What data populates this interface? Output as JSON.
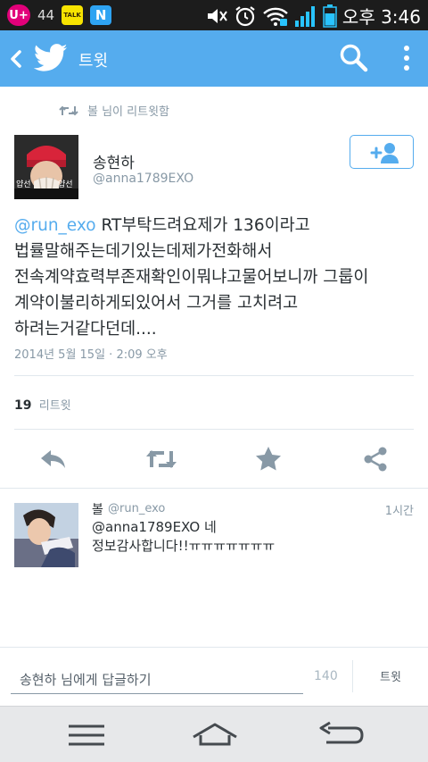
{
  "status_bar": {
    "carrier": "U+",
    "signal_number": "44",
    "talk_label": "TALK",
    "n_label": "N",
    "time": "오후 3:46",
    "icons": [
      "mute-icon",
      "alarm-icon",
      "wifi-icon",
      "signal-icon",
      "battery-icon"
    ]
  },
  "header": {
    "title": "트윗",
    "icons": [
      "back-icon",
      "twitter-bird-icon",
      "search-icon",
      "more-vert-icon"
    ],
    "color": "#55acee"
  },
  "tweet": {
    "retweeted_by": "볼 님이 리트윗함",
    "author_name": "송현하",
    "author_handle": "@anna1789EXO",
    "mention": "@run_exo",
    "lines": [
      " RT부탁드려요제가 136이라고",
      "법률말해주는데기있는데제가전화해서",
      "전속계약효력부존재확인이뭐냐고물어보니까 그룹이",
      "계약이불리하게되있어서 그거를 고치려고",
      "하려는거같다던데...."
    ],
    "date": "2014년 5월 15일 · 2:09 오후",
    "retweet_count": "19",
    "retweet_label": "리트윗",
    "avatar_caption_left": "얍선",
    "avatar_caption_right": "얍선"
  },
  "actions": [
    "reply-icon",
    "retweet-icon",
    "favorite-icon",
    "share-icon"
  ],
  "reply": {
    "name": "볼",
    "handle": "@run_exo",
    "time": "1시간",
    "line1": "@anna1789EXO 네",
    "line2": "정보감사합니다!!ㅠㅠㅠㅠㅠㅠㅠ"
  },
  "compose": {
    "placeholder": "송현하 님에게 답글하기",
    "count": "140",
    "button": "트윗"
  },
  "nav": [
    "menu-icon",
    "home-icon",
    "back-nav-icon"
  ]
}
